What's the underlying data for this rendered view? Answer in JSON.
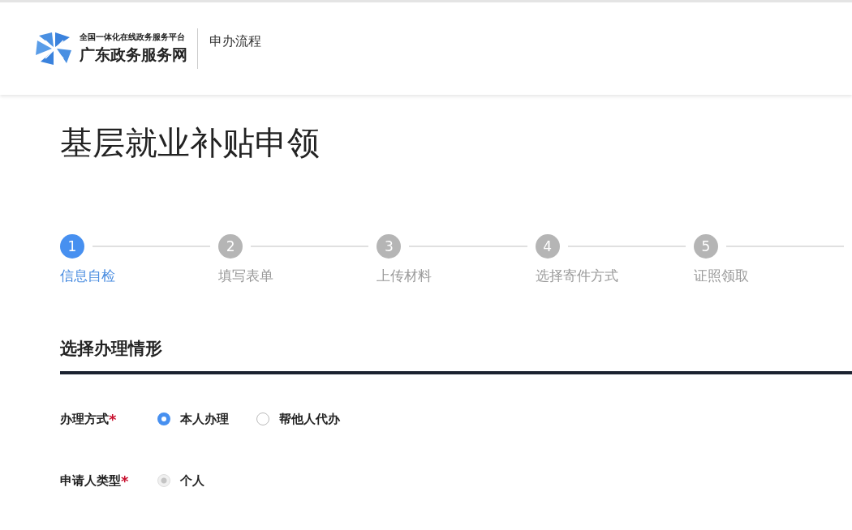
{
  "header": {
    "logo_subtitle": "全国一体化在线政务服务平台",
    "logo_title": "广东政务服务网",
    "nav_label": "申办流程"
  },
  "page_title": "基层就业补贴申领",
  "steps": [
    {
      "number": "1",
      "label": "信息自检",
      "selected": true
    },
    {
      "number": "2",
      "label": "填写表单",
      "selected": false
    },
    {
      "number": "3",
      "label": "上传材料",
      "selected": false
    },
    {
      "number": "4",
      "label": "选择寄件方式",
      "selected": false
    },
    {
      "number": "5",
      "label": "证照领取",
      "selected": false
    }
  ],
  "section_title": "选择办理情形",
  "fields": [
    {
      "label": "办理方式",
      "required_mark": "*",
      "options": [
        {
          "label": "本人办理",
          "selected": true,
          "disabled": false
        },
        {
          "label": "帮他人代办",
          "selected": false,
          "disabled": false
        }
      ]
    },
    {
      "label": "申请人类型",
      "required_mark": "*",
      "options": [
        {
          "label": "个人",
          "selected": true,
          "disabled": true
        }
      ]
    }
  ]
}
